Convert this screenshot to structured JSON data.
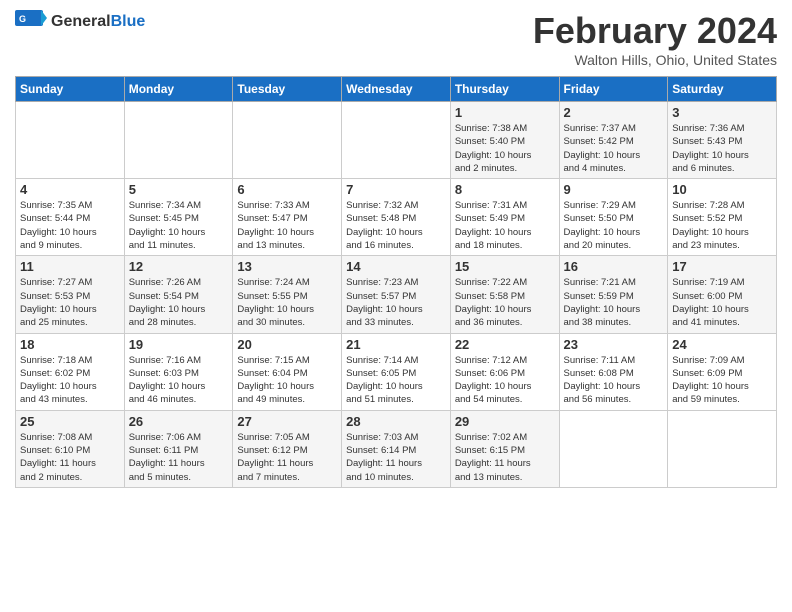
{
  "header": {
    "logo_general": "General",
    "logo_blue": "Blue",
    "month_title": "February 2024",
    "location": "Walton Hills, Ohio, United States"
  },
  "weekdays": [
    "Sunday",
    "Monday",
    "Tuesday",
    "Wednesday",
    "Thursday",
    "Friday",
    "Saturday"
  ],
  "weeks": [
    [
      {
        "day": "",
        "info": ""
      },
      {
        "day": "",
        "info": ""
      },
      {
        "day": "",
        "info": ""
      },
      {
        "day": "",
        "info": ""
      },
      {
        "day": "1",
        "info": "Sunrise: 7:38 AM\nSunset: 5:40 PM\nDaylight: 10 hours\nand 2 minutes."
      },
      {
        "day": "2",
        "info": "Sunrise: 7:37 AM\nSunset: 5:42 PM\nDaylight: 10 hours\nand 4 minutes."
      },
      {
        "day": "3",
        "info": "Sunrise: 7:36 AM\nSunset: 5:43 PM\nDaylight: 10 hours\nand 6 minutes."
      }
    ],
    [
      {
        "day": "4",
        "info": "Sunrise: 7:35 AM\nSunset: 5:44 PM\nDaylight: 10 hours\nand 9 minutes."
      },
      {
        "day": "5",
        "info": "Sunrise: 7:34 AM\nSunset: 5:45 PM\nDaylight: 10 hours\nand 11 minutes."
      },
      {
        "day": "6",
        "info": "Sunrise: 7:33 AM\nSunset: 5:47 PM\nDaylight: 10 hours\nand 13 minutes."
      },
      {
        "day": "7",
        "info": "Sunrise: 7:32 AM\nSunset: 5:48 PM\nDaylight: 10 hours\nand 16 minutes."
      },
      {
        "day": "8",
        "info": "Sunrise: 7:31 AM\nSunset: 5:49 PM\nDaylight: 10 hours\nand 18 minutes."
      },
      {
        "day": "9",
        "info": "Sunrise: 7:29 AM\nSunset: 5:50 PM\nDaylight: 10 hours\nand 20 minutes."
      },
      {
        "day": "10",
        "info": "Sunrise: 7:28 AM\nSunset: 5:52 PM\nDaylight: 10 hours\nand 23 minutes."
      }
    ],
    [
      {
        "day": "11",
        "info": "Sunrise: 7:27 AM\nSunset: 5:53 PM\nDaylight: 10 hours\nand 25 minutes."
      },
      {
        "day": "12",
        "info": "Sunrise: 7:26 AM\nSunset: 5:54 PM\nDaylight: 10 hours\nand 28 minutes."
      },
      {
        "day": "13",
        "info": "Sunrise: 7:24 AM\nSunset: 5:55 PM\nDaylight: 10 hours\nand 30 minutes."
      },
      {
        "day": "14",
        "info": "Sunrise: 7:23 AM\nSunset: 5:57 PM\nDaylight: 10 hours\nand 33 minutes."
      },
      {
        "day": "15",
        "info": "Sunrise: 7:22 AM\nSunset: 5:58 PM\nDaylight: 10 hours\nand 36 minutes."
      },
      {
        "day": "16",
        "info": "Sunrise: 7:21 AM\nSunset: 5:59 PM\nDaylight: 10 hours\nand 38 minutes."
      },
      {
        "day": "17",
        "info": "Sunrise: 7:19 AM\nSunset: 6:00 PM\nDaylight: 10 hours\nand 41 minutes."
      }
    ],
    [
      {
        "day": "18",
        "info": "Sunrise: 7:18 AM\nSunset: 6:02 PM\nDaylight: 10 hours\nand 43 minutes."
      },
      {
        "day": "19",
        "info": "Sunrise: 7:16 AM\nSunset: 6:03 PM\nDaylight: 10 hours\nand 46 minutes."
      },
      {
        "day": "20",
        "info": "Sunrise: 7:15 AM\nSunset: 6:04 PM\nDaylight: 10 hours\nand 49 minutes."
      },
      {
        "day": "21",
        "info": "Sunrise: 7:14 AM\nSunset: 6:05 PM\nDaylight: 10 hours\nand 51 minutes."
      },
      {
        "day": "22",
        "info": "Sunrise: 7:12 AM\nSunset: 6:06 PM\nDaylight: 10 hours\nand 54 minutes."
      },
      {
        "day": "23",
        "info": "Sunrise: 7:11 AM\nSunset: 6:08 PM\nDaylight: 10 hours\nand 56 minutes."
      },
      {
        "day": "24",
        "info": "Sunrise: 7:09 AM\nSunset: 6:09 PM\nDaylight: 10 hours\nand 59 minutes."
      }
    ],
    [
      {
        "day": "25",
        "info": "Sunrise: 7:08 AM\nSunset: 6:10 PM\nDaylight: 11 hours\nand 2 minutes."
      },
      {
        "day": "26",
        "info": "Sunrise: 7:06 AM\nSunset: 6:11 PM\nDaylight: 11 hours\nand 5 minutes."
      },
      {
        "day": "27",
        "info": "Sunrise: 7:05 AM\nSunset: 6:12 PM\nDaylight: 11 hours\nand 7 minutes."
      },
      {
        "day": "28",
        "info": "Sunrise: 7:03 AM\nSunset: 6:14 PM\nDaylight: 11 hours\nand 10 minutes."
      },
      {
        "day": "29",
        "info": "Sunrise: 7:02 AM\nSunset: 6:15 PM\nDaylight: 11 hours\nand 13 minutes."
      },
      {
        "day": "",
        "info": ""
      },
      {
        "day": "",
        "info": ""
      }
    ]
  ]
}
